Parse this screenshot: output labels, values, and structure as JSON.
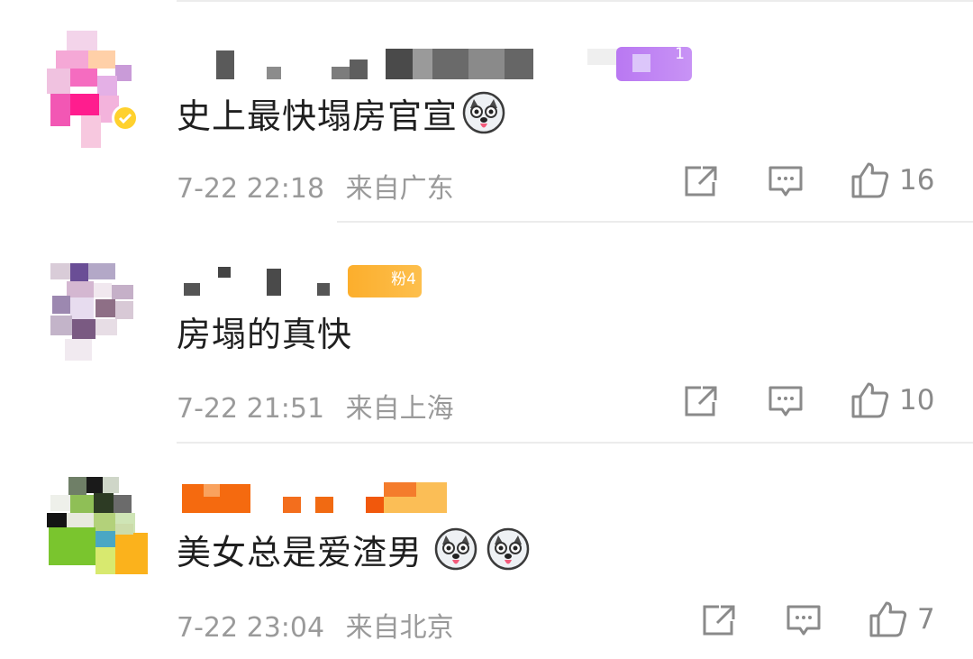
{
  "comments": [
    {
      "text": "史上最快塌房官宣",
      "emoji_count": 1,
      "badge": "1",
      "time": "7-22 22:18",
      "location": "来自广东",
      "likes": "16"
    },
    {
      "text": "房塌的真快",
      "emoji_count": 0,
      "badge": "粉4",
      "time": "7-22 21:51",
      "location": "来自上海",
      "likes": "10"
    },
    {
      "text": "美女总是爱渣男",
      "emoji_count": 2,
      "badge": "",
      "time": "7-22 23:04",
      "location": "来自北京",
      "likes": "7"
    }
  ],
  "icons": {
    "share": "share-icon",
    "comment": "comment-icon",
    "like": "thumbs-up-icon",
    "emoji": "husky-dog-emoji"
  },
  "colors": {
    "text": "#1f1f1f",
    "meta": "#9a9a9a",
    "badge_purple": "#b678f0",
    "badge_orange": "#fcb23c"
  }
}
